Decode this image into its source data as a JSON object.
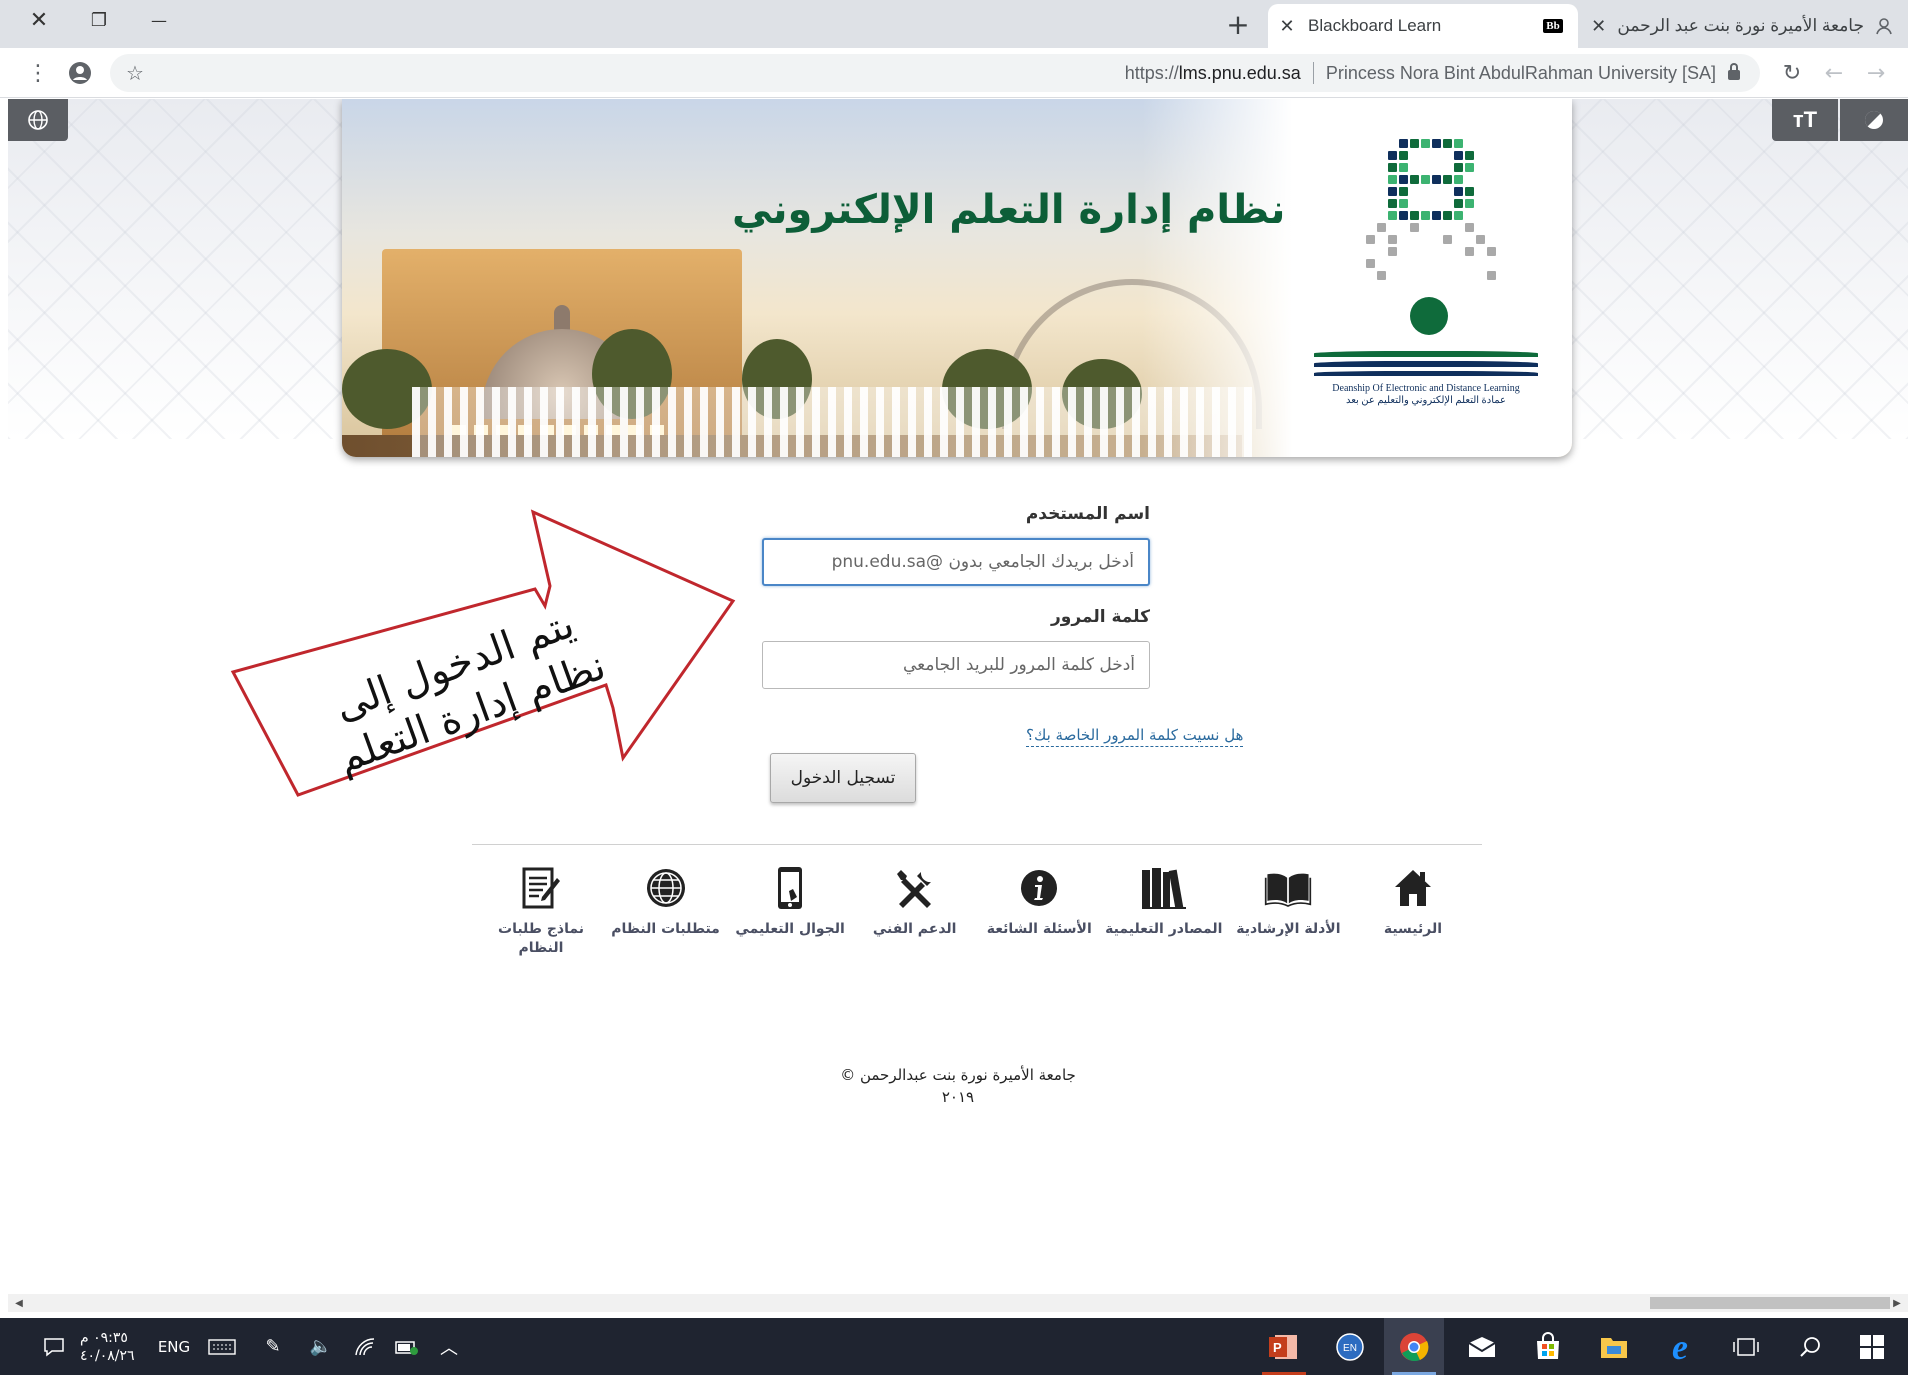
{
  "window": {
    "close_label": "✕",
    "restore_label": "❐",
    "minimize_label": "—"
  },
  "tabs": [
    {
      "title": "Blackboard Learn",
      "favicon": "Bb",
      "active": true
    },
    {
      "title": "جامعة الأميرة نورة بنت عبد الرحمن",
      "active": false
    }
  ],
  "omnibox": {
    "url_prefix": "https://",
    "url_host": "lms.pnu.edu.sa",
    "site_identity": "Princess Nora Bint AbdulRahman University [SA]"
  },
  "banner": {
    "title": "نظام إدارة التعلم الإلكتروني",
    "logo_caption_en": "Deanship Of Electronic and Distance Learning",
    "logo_caption_ar": "عمادة التعلم الإلكتروني والتعليم عن بعد"
  },
  "login": {
    "username_label": "اسم المستخدم",
    "username_placeholder": "أدخل بريدك الجامعي بدون @pnu.edu.sa",
    "password_label": "كلمة المرور",
    "password_placeholder": "أدخل كلمة المرور للبريد الجامعي",
    "forgot_link": "هل نسيت كلمة المرور الخاصة بك؟",
    "submit_label": "تسجيل الدخول"
  },
  "callout": {
    "line1": "يتم الدخول إلى",
    "line2": "نظام إدارة التعلم",
    "border_color": "#c0272d"
  },
  "nav": {
    "items": [
      {
        "label": "الرئيسية",
        "icon": "home-icon"
      },
      {
        "label": "الأدلة الإرشادية",
        "icon": "open-book-icon"
      },
      {
        "label": "المصادر التعليمية",
        "icon": "books-icon"
      },
      {
        "label": "الأسئلة الشائعة",
        "icon": "info-icon"
      },
      {
        "label": "الدعم الفني",
        "icon": "tools-icon"
      },
      {
        "label": "الجوال التعليمي",
        "icon": "mobile-icon"
      },
      {
        "label": "متطلبات النظام",
        "icon": "globe-icon"
      },
      {
        "label": "نماذج طلبات النظام",
        "icon": "form-icon"
      }
    ]
  },
  "footer": {
    "copyright_line1": "جامعة الأميرة نورة بنت عبدالرحمن ©",
    "copyright_line2": "٢٠١٩"
  },
  "taskbar": {
    "time": "٠٩:٣٥ م",
    "date": "٤٠/٠٨/٢٦",
    "language": "ENG",
    "lang_badge": "EN"
  },
  "colors": {
    "brand_green": "#0d5e38",
    "link_blue": "#2a6a9e",
    "focus_blue": "#4a86c7",
    "nav_text": "#4a4f63"
  }
}
